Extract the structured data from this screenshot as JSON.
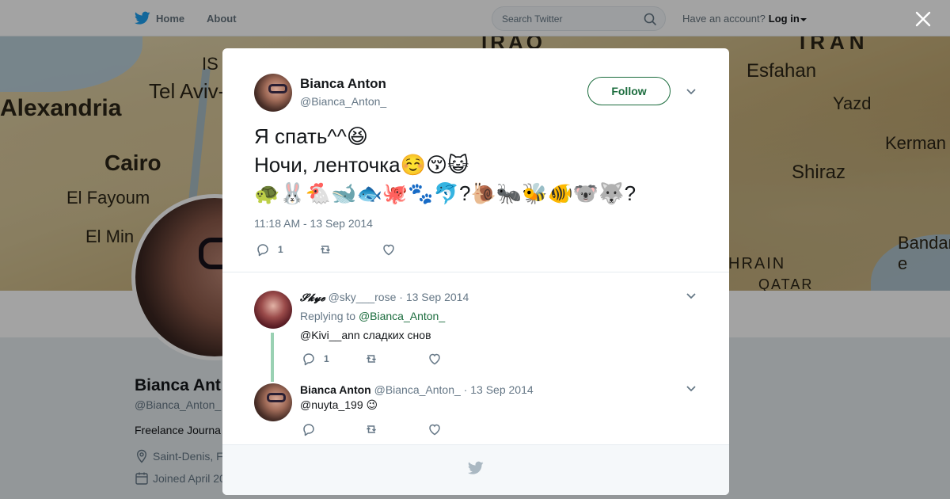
{
  "topbar": {
    "home_label": "Home",
    "about_label": "About",
    "search_placeholder": "Search Twitter",
    "account_prompt": "Have an account?",
    "login_label": "Log in"
  },
  "banner": {
    "labels": [
      "Tel Aviv-",
      "Alexandria",
      "Cairo",
      "El Fayoum",
      "El Min",
      "IS",
      "IRAQ",
      "IRAN",
      "Esfahan",
      "Yazd",
      "Kerman",
      "Shiraz",
      "Bandar-e",
      "HRAIN",
      "QATAR"
    ]
  },
  "profile": {
    "name": "Bianca Ant",
    "handle": "@Bianca_Anton_",
    "bio": "Freelance Journa",
    "location": "Saint-Denis, F",
    "joined": "Joined April 20"
  },
  "tweet": {
    "name": "Bianca Anton",
    "handle": "@Bianca_Anton_",
    "follow_label": "Follow",
    "text_lines": [
      "Я спать^^😆",
      "Ночи,  ленточка☺️😚😺",
      "🐢🐰🐔🐋🐟🐙🐾🐬?🐌🐜🐝🐠🐨🐺?"
    ],
    "timestamp": "11:18 AM - 13 Sep 2014",
    "reply_count": "1"
  },
  "replies": [
    {
      "name": "𝓢𝓴𝔂𝓮",
      "handle": "@sky___rose",
      "date": "· 13 Sep 2014",
      "replying_to_prefix": "Replying to",
      "replying_to_handle": "@Bianca_Anton_",
      "text": "@Kivi__ann сладких снов",
      "reply_count": "1"
    },
    {
      "name": "Bianca Anton",
      "handle": "@Bianca_Anton_",
      "date": "· 13 Sep 2014",
      "text": "@nuyta_199 😉"
    }
  ],
  "colors": {
    "accent_green": "#1b6c3d",
    "thread_line": "#9ad1b3",
    "muted_text": "#657786",
    "twitter_blue": "#1da1f2"
  }
}
